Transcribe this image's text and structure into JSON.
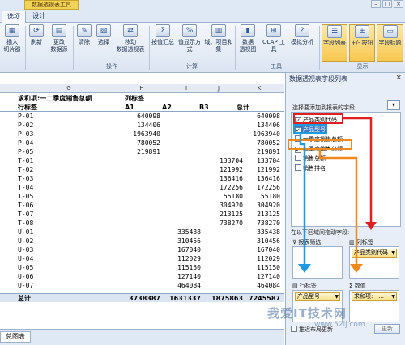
{
  "titlebar": {
    "context_tab": "数据透视表工具",
    "win_buttons": [
      "–",
      "□",
      "×"
    ]
  },
  "tabs": [
    {
      "label": "选项",
      "active": true
    },
    {
      "label": "设计",
      "active": false
    }
  ],
  "ribbon": {
    "buttons": [
      {
        "id": "insert-slicer",
        "label": "插入\n切片器",
        "icon": "▦"
      },
      {
        "id": "refresh",
        "label": "刷新",
        "icon": "⟳"
      },
      {
        "id": "change-source",
        "label": "更改\n数据源",
        "icon": "▤"
      },
      {
        "id": "clear",
        "label": "清除",
        "icon": "✎"
      },
      {
        "id": "select",
        "label": "选择",
        "icon": "▧"
      },
      {
        "id": "move-pivot",
        "label": "移动\n数据透视表",
        "icon": "⇄"
      },
      {
        "id": "summarize-by",
        "label": "按值汇总",
        "icon": "Σ"
      },
      {
        "id": "show-values-as",
        "label": "值显示方式",
        "icon": "%"
      },
      {
        "id": "fields-items-sets",
        "label": "域、项目和\n集",
        "icon": "▥"
      },
      {
        "id": "pivot-chart",
        "label": "数据\n透视图",
        "icon": "▮"
      },
      {
        "id": "olap",
        "label": "OLAP 工具",
        "icon": "⊞"
      },
      {
        "id": "what-if",
        "label": "模拟分析",
        "icon": "?"
      },
      {
        "id": "field-list",
        "label": "字段列表",
        "icon": "☰",
        "highlighted": true
      },
      {
        "id": "plus-minus",
        "label": "+/- 按钮",
        "icon": "±",
        "highlighted": true
      },
      {
        "id": "field-headers",
        "label": "字段标题",
        "icon": "▭",
        "highlighted": true
      }
    ],
    "groups": [
      "操作",
      "计算",
      "工具",
      "显示"
    ]
  },
  "grid": {
    "columns": [
      "G",
      "H",
      "I",
      "J",
      "K"
    ],
    "header_row": {
      "title": "求和项:一二季度销售总额",
      "col_label": "列标签"
    },
    "label_row": {
      "row_label": "行标签",
      "c1": "A1",
      "c2": "A2",
      "c3": "B3",
      "total": "总计"
    },
    "rows": [
      {
        "label": "P-01",
        "a1": "640098",
        "a2": "",
        "b3": "",
        "total": "640098"
      },
      {
        "label": "P-02",
        "a1": "134406",
        "a2": "",
        "b3": "",
        "total": "134406"
      },
      {
        "label": "P-03",
        "a1": "1963940",
        "a2": "",
        "b3": "",
        "total": "1963940"
      },
      {
        "label": "P-04",
        "a1": "780052",
        "a2": "",
        "b3": "",
        "total": "780052"
      },
      {
        "label": "P-05",
        "a1": "219891",
        "a2": "",
        "b3": "",
        "total": "219891"
      },
      {
        "label": "T-01",
        "a1": "",
        "a2": "",
        "b3": "133704",
        "total": "133704"
      },
      {
        "label": "T-02",
        "a1": "",
        "a2": "",
        "b3": "121992",
        "total": "121992"
      },
      {
        "label": "T-03",
        "a1": "",
        "a2": "",
        "b3": "136416",
        "total": "136416"
      },
      {
        "label": "T-04",
        "a1": "",
        "a2": "",
        "b3": "172256",
        "total": "172256"
      },
      {
        "label": "T-05",
        "a1": "",
        "a2": "",
        "b3": "55180",
        "total": "55180"
      },
      {
        "label": "T-06",
        "a1": "",
        "a2": "",
        "b3": "304920",
        "total": "304920"
      },
      {
        "label": "T-07",
        "a1": "",
        "a2": "",
        "b3": "213125",
        "total": "213125"
      },
      {
        "label": "T-08",
        "a1": "",
        "a2": "",
        "b3": "738270",
        "total": "738270"
      },
      {
        "label": "U-01",
        "a1": "",
        "a2": "335438",
        "b3": "",
        "total": "335438"
      },
      {
        "label": "U-02",
        "a1": "",
        "a2": "310456",
        "b3": "",
        "total": "310456"
      },
      {
        "label": "U-03",
        "a1": "",
        "a2": "167040",
        "b3": "",
        "total": "167040"
      },
      {
        "label": "U-04",
        "a1": "",
        "a2": "112029",
        "b3": "",
        "total": "112029"
      },
      {
        "label": "U-05",
        "a1": "",
        "a2": "115150",
        "b3": "",
        "total": "115150"
      },
      {
        "label": "U-06",
        "a1": "",
        "a2": "127140",
        "b3": "",
        "total": "127140"
      },
      {
        "label": "U-07",
        "a1": "",
        "a2": "464084",
        "b3": "",
        "total": "464084"
      }
    ],
    "total_row": {
      "label": "总计",
      "a1": "3738387",
      "a2": "1631337",
      "b3": "1875863",
      "total": "7245587"
    }
  },
  "sheet_tab": "总图表",
  "field_pane": {
    "title": "数据透视表字段列表",
    "close": "×",
    "instruction": "选择要添加到报表的字段:",
    "gear": "▾",
    "fields": [
      {
        "label": "产品类别代码",
        "checked": true,
        "selected": false
      },
      {
        "label": "产品型号",
        "checked": true,
        "selected": true
      },
      {
        "label": "一季度销售总额",
        "checked": false,
        "selected": false
      },
      {
        "label": "二季度销售总额",
        "checked": true,
        "selected": false
      },
      {
        "label": "销售总额",
        "checked": false,
        "selected": false
      },
      {
        "label": "销售排名",
        "checked": false,
        "selected": false
      }
    ],
    "drag_instruction": "在以下区域间拖动字段:",
    "report_filter": "报表筛选",
    "column_labels": "列标签",
    "row_labels": "行标签",
    "values": "数值",
    "col_chip": "产品类别代码",
    "row_chip": "产品型号",
    "val_chip": "求和项:一...",
    "defer": "推迟布局更新",
    "update": "更新"
  },
  "annotations": {
    "colors": {
      "red": "#e02020",
      "blue": "#1e9be0",
      "orange": "#f08a1c"
    }
  },
  "watermark": {
    "text": "我爱IT技术网",
    "url": "www.52ij.com"
  }
}
